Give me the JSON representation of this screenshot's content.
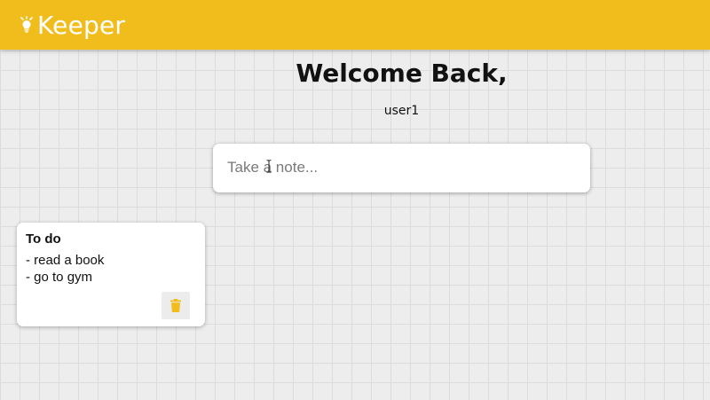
{
  "header": {
    "app_name": "Keeper",
    "logo_icon": "lightbulb-icon"
  },
  "greeting": {
    "title": "Welcome Back,",
    "username": "user1"
  },
  "create_note": {
    "placeholder": "Take a note...",
    "value": ""
  },
  "notes": [
    {
      "title": "To do",
      "lines": [
        "- read a book",
        "- go to gym"
      ],
      "delete_icon": "trash-icon"
    }
  ],
  "colors": {
    "accent": "#f0bd1d",
    "background": "#ededed",
    "card": "#ffffff"
  }
}
